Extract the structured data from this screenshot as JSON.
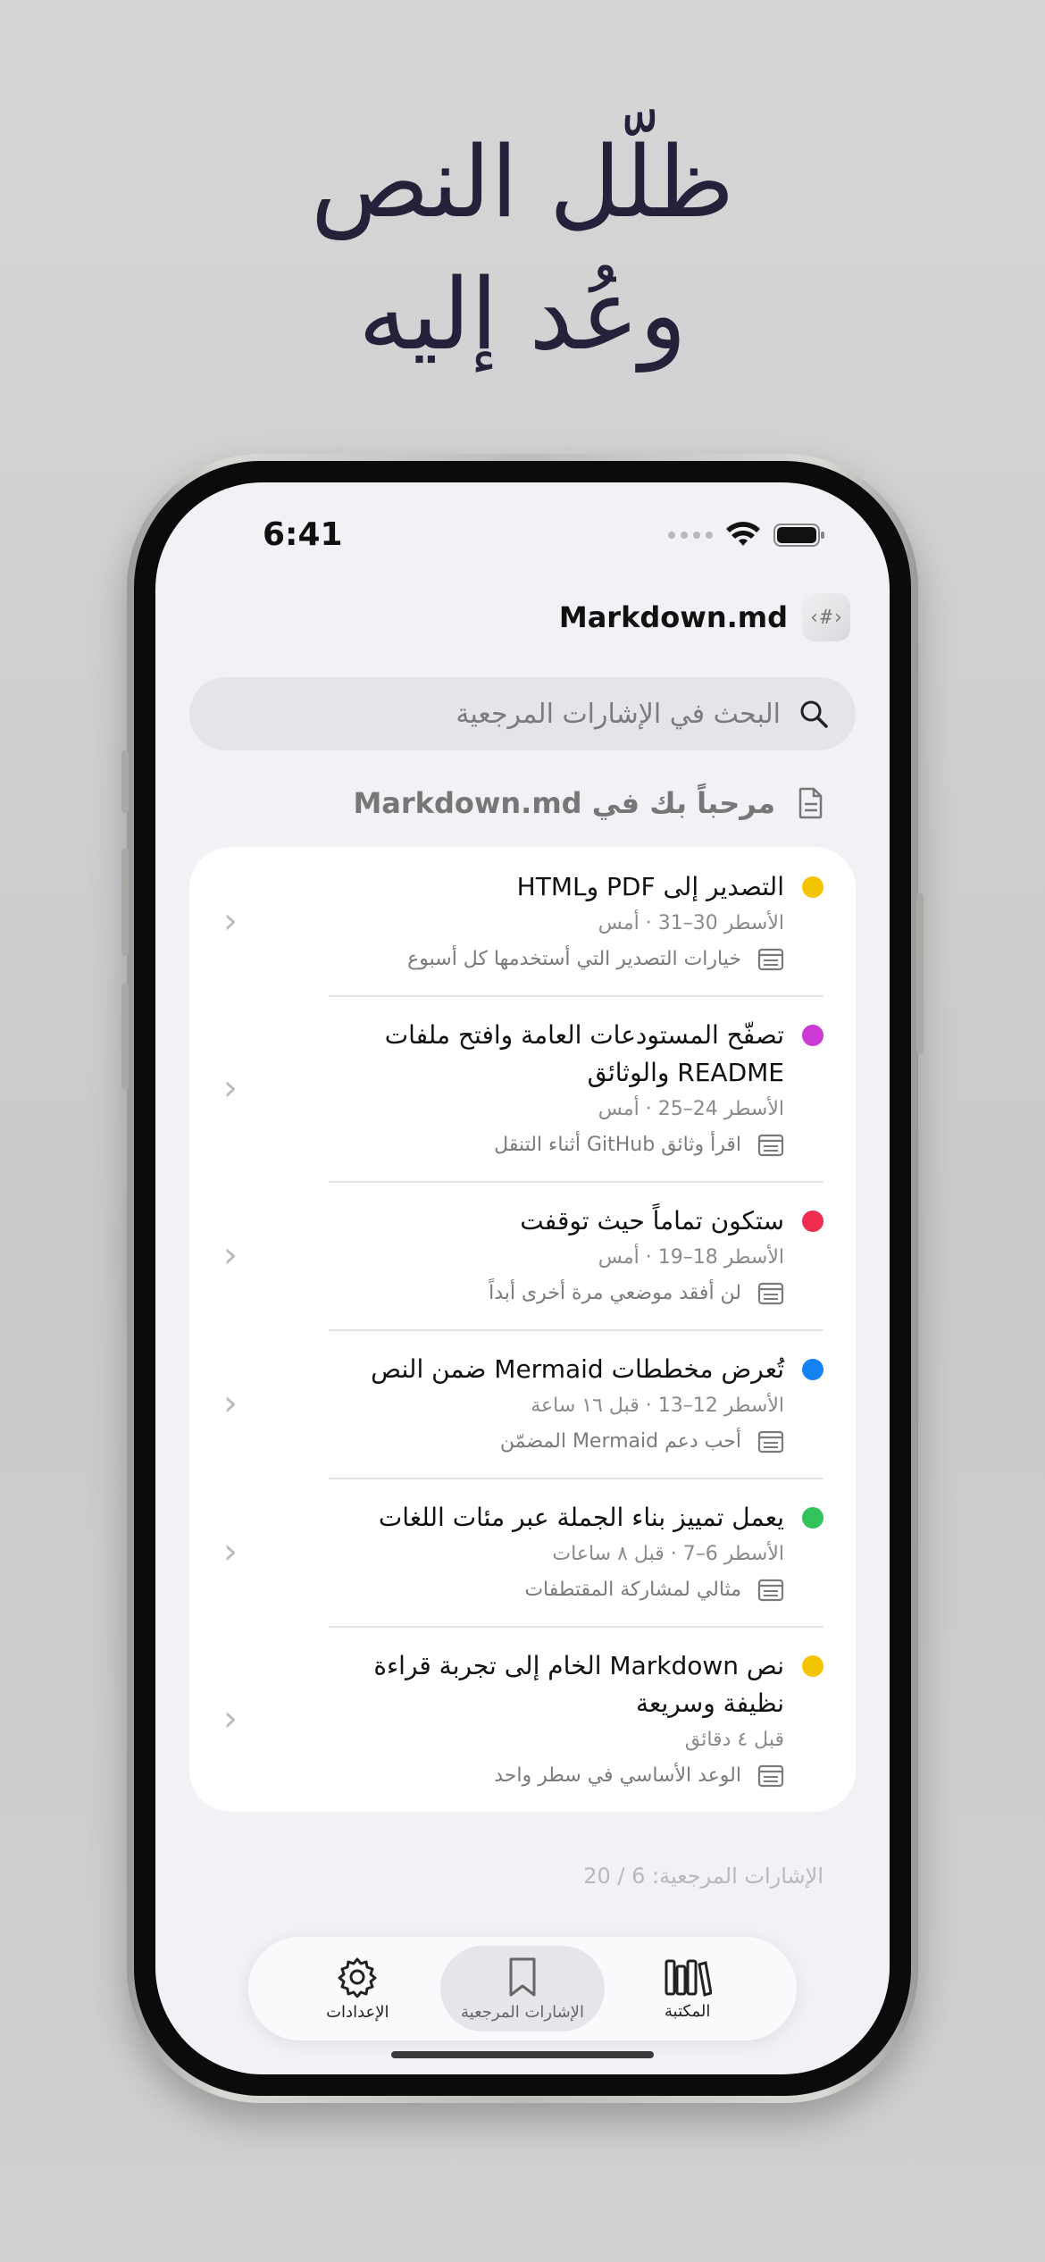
{
  "headline": {
    "line1": "ظلّل النص",
    "line2": "وعُد إليه"
  },
  "status": {
    "time": "6:41"
  },
  "app": {
    "title": "Markdown.md"
  },
  "search": {
    "placeholder": "البحث في الإشارات المرجعية"
  },
  "section": {
    "title": "مرحباً بك في Markdown.md"
  },
  "bookmarks": [
    {
      "color": "#f5c400",
      "title": "التصدير إلى PDF وHTML",
      "meta": "الأسطر 30–31  ·  أمس",
      "note": "خيارات التصدير التي أستخدمها كل أسبوع"
    },
    {
      "color": "#cc3ad6",
      "title": "تصفّح المستودعات العامة وافتح ملفات README والوثائق",
      "meta": "الأسطر 24–25  ·  أمس",
      "note": "اقرأ وثائق GitHub أثناء التنقل"
    },
    {
      "color": "#ef2d51",
      "title": "ستكون تماماً حيث توقفت",
      "meta": "الأسطر 18–19  ·  أمس",
      "note": "لن أفقد موضعي مرة أخرى أبداً"
    },
    {
      "color": "#1682f3",
      "title": "تُعرض مخططات Mermaid ضمن النص",
      "meta": "الأسطر 12–13  ·  قبل ١٦ ساعة",
      "note": "أحب دعم Mermaid المضمّن"
    },
    {
      "color": "#32c35a",
      "title": "يعمل تمييز بناء الجملة عبر مئات اللغات",
      "meta": "الأسطر 6–7  ·  قبل ٨ ساعات",
      "note": "مثالي لمشاركة المقتطفات"
    },
    {
      "color": "#f5c400",
      "title": "نص Markdown الخام إلى تجربة قراءة نظيفة وسريعة",
      "meta": "قبل ٤ دقائق",
      "note": "الوعد الأساسي في سطر واحد"
    }
  ],
  "count": "الإشارات المرجعية: 6 / 20",
  "tabs": [
    {
      "label": "المكتبة",
      "icon": "library-icon"
    },
    {
      "label": "الإشارات المرجعية",
      "icon": "bookmark-icon"
    },
    {
      "label": "الإعدادات",
      "icon": "gear-icon"
    }
  ]
}
